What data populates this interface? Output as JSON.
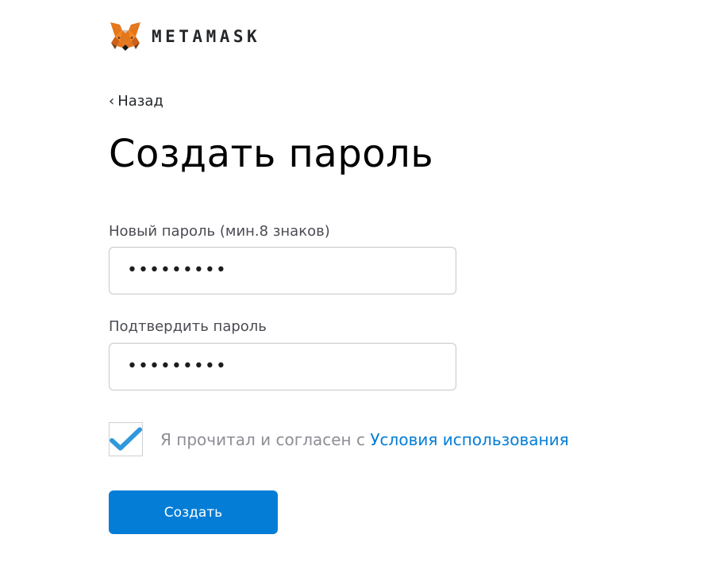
{
  "brand": {
    "wordmark": "METAMASK",
    "logo_icon": "fox-logo-icon"
  },
  "nav": {
    "back_chevron": "‹",
    "back_label": "Назад"
  },
  "page": {
    "title": "Создать пароль"
  },
  "form": {
    "new_password": {
      "label": "Новый пароль (мин.8 знаков)",
      "value_masked": "•••••••••"
    },
    "confirm_password": {
      "label": "Подтвердить пароль",
      "value_masked": "•••••••••"
    }
  },
  "terms": {
    "checked": true,
    "text": "Я прочитал и согласен с ",
    "link_text": "Условия использования"
  },
  "actions": {
    "create_label": "Создать"
  },
  "colors": {
    "accent": "#037dd6",
    "fox_orange": "#e2761b",
    "check_blue": "#3098dc"
  }
}
